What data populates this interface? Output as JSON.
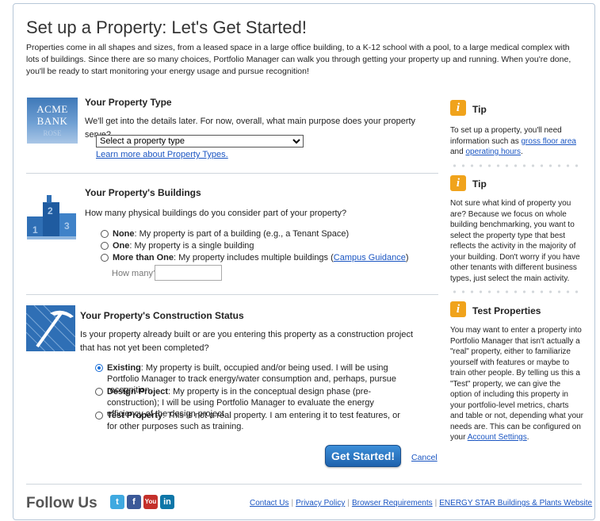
{
  "page": {
    "title": "Set up a Property: Let's Get Started!",
    "intro": "Properties come in all shapes and sizes, from a leased space in a large office building, to a K-12 school with a pool, to a large medical complex with lots of buildings. Since there are so many choices, Portfolio Manager can walk you through getting your property up and running. When you're done, you'll be ready to start monitoring your energy usage and pursue recognition!"
  },
  "property_type": {
    "heading": "Your Property Type",
    "question": "We'll get into the details later. For now, overall, what main purpose does your property serve?",
    "select_value": "Select a property type",
    "learn_more": "Learn more about Property Types.",
    "image_line1": "ACME",
    "image_line2": "BANK",
    "image_line3": "ROSE"
  },
  "buildings": {
    "heading": "Your Property's Buildings",
    "question": "How many physical buildings do you consider part of your property?",
    "options": [
      {
        "bold": "None",
        "text": ": My property is part of a building (e.g., a Tenant Space)"
      },
      {
        "bold": "One",
        "text": ": My property is a single building"
      },
      {
        "bold": "More than One",
        "text": ": My property includes multiple buildings (",
        "link": "Campus Guidance",
        "tail": ")"
      }
    ],
    "how_many_label": "How many?"
  },
  "construction": {
    "heading": "Your Property's Construction Status",
    "question": "Is your property already built or are you entering this property as a construction project that has not yet been completed?",
    "options": [
      {
        "bold": "Existing",
        "text": ": My property is built, occupied and/or being used. I will be using Portfolio Manager to track energy/water consumption and, perhaps, pursue recognition.",
        "selected": true
      },
      {
        "bold": "Design Project",
        "text": ": My property is in the conceptual design phase (pre-construction); I will be using Portfolio Manager to evaluate the energy efficiency of the design project.",
        "selected": false
      },
      {
        "bold": "Test Property",
        "text": ": This is not a real property. I am entering it to test features, or for other purposes such as training.",
        "selected": false
      }
    ]
  },
  "actions": {
    "get_started": "Get Started!",
    "cancel": "Cancel"
  },
  "sidebar": {
    "tip1": {
      "heading": "Tip",
      "text_before": "To set up a property, you'll need information such as ",
      "link1": "gross floor area",
      "text_mid": " and ",
      "link2": "operating hours",
      "text_after": "."
    },
    "tip2": {
      "heading": "Tip",
      "text": "Not sure what kind of property you are? Because we focus on whole building benchmarking, you want to select the property type that best reflects the activity in the majority of your building. Don't worry if you have other tenants with different business types, just select the main activity."
    },
    "tip3": {
      "heading": "Test Properties",
      "text_before": "You may want to enter a property into Portfolio Manager that isn't actually a \"real\" property, either to familiarize yourself with features or maybe to train other people. By telling us this a \"Test\" property, we can give the option of including this property in your portfolio-level metrics, charts and table or not, depending what your needs are. This can be configured on your ",
      "link": "Account Settings",
      "text_after": "."
    },
    "icon_glyph": "i"
  },
  "footer": {
    "follow_us": "Follow Us",
    "social": [
      {
        "name": "twitter",
        "glyph": "t",
        "color": "#3fa9e0"
      },
      {
        "name": "facebook",
        "glyph": "f",
        "color": "#3b5998"
      },
      {
        "name": "youtube",
        "glyph": "You",
        "color": "#c4302b"
      },
      {
        "name": "linkedin",
        "glyph": "in",
        "color": "#0e76a8"
      }
    ],
    "links": [
      "Contact Us",
      "Privacy Policy",
      "Browser Requirements",
      "ENERGY STAR Buildings & Plants Website"
    ],
    "separator": "|"
  }
}
